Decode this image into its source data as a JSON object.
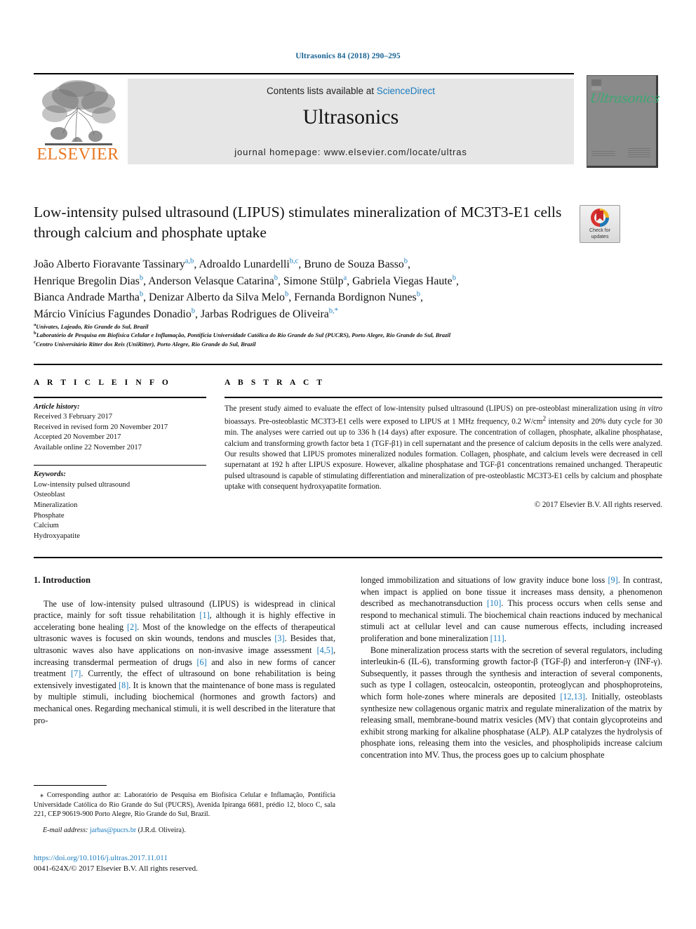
{
  "running_head": "Ultrasonics 84 (2018) 290–295",
  "masthead": {
    "publisher": "ELSEVIER",
    "contents_prefix": "Contents lists available at ",
    "contents_link": "ScienceDirect",
    "journal_name": "Ultrasonics",
    "homepage": "journal homepage: www.elsevier.com/locate/ultras",
    "cover_title": "Ultrasonics"
  },
  "crossmark": {
    "line1": "Check for",
    "line2": "updates"
  },
  "article": {
    "title": "Low-intensity pulsed ultrasound (LIPUS) stimulates mineralization of MC3T3-E1 cells through calcium and phosphate uptake",
    "authors_line1_a": "João Alberto Fioravante Tassinary",
    "authors_line1_a_sup": "a,b",
    "authors_line1_b": ", Adroaldo Lunardelli",
    "authors_line1_b_sup": "b,c",
    "authors_line1_c": ", Bruno de Souza Basso",
    "authors_line1_c_sup": "b",
    "authors_line1_end": ",",
    "authors_line2_a": "Henrique Bregolin Dias",
    "authors_line2_a_sup": "b",
    "authors_line2_b": ", Anderson Velasque Catarina",
    "authors_line2_b_sup": "b",
    "authors_line2_c": ", Simone Stülp",
    "authors_line2_c_sup": "a",
    "authors_line2_d": ", Gabriela Viegas Haute",
    "authors_line2_d_sup": "b",
    "authors_line2_end": ",",
    "authors_line3_a": "Bianca Andrade Martha",
    "authors_line3_a_sup": "b",
    "authors_line3_b": ", Denizar Alberto da Silva Melo",
    "authors_line3_b_sup": "b",
    "authors_line3_c": ", Fernanda Bordignon Nunes",
    "authors_line3_c_sup": "b",
    "authors_line3_end": ",",
    "authors_line4_a": "Márcio Vinícius Fagundes Donadio",
    "authors_line4_a_sup": "b",
    "authors_line4_b": ", Jarbas Rodrigues de Oliveira",
    "authors_line4_b_sup": "b,*",
    "affiliation_a_sup": "a",
    "affiliation_a": "Univates, Lajeado, Rio Grande do Sul, Brazil",
    "affiliation_b_sup": "b",
    "affiliation_b": "Laboratório de Pesquisa em Biofísica Celular e Inflamação, Pontifícia Universidade Católica do Rio Grande do Sul (PUCRS), Porto Alegre, Rio Grande do Sul, Brazil",
    "affiliation_c_sup": "c",
    "affiliation_c": "Centro Universitário Ritter dos Reis (UniRitter), Porto Alegre, Rio Grande do Sul, Brazil"
  },
  "article_info": {
    "heading": "A R T I C L E   I N F O",
    "history_label": "Article history:",
    "history": [
      "Received 3 February 2017",
      "Received in revised form 20 November 2017",
      "Accepted 20 November 2017",
      "Available online 22 November 2017"
    ],
    "keywords_label": "Keywords:",
    "keywords": [
      "Low-intensity pulsed ultrasound",
      "Osteoblast",
      "Mineralization",
      "Phosphate",
      "Calcium",
      "Hydroxyapatite"
    ]
  },
  "abstract": {
    "heading": "A B S T R A C T",
    "text_part1": "The present study aimed to evaluate the effect of low-intensity pulsed ultrasound (LIPUS) on pre-osteoblast mineralization using ",
    "text_italic1": "in vitro",
    "text_part2": " bioassays. Pre-osteoblastic MC3T3-E1 cells were exposed to LIPUS at 1 MHz frequency, 0.2 W/cm",
    "text_sup1": "2",
    "text_part3": " intensity and 20% duty cycle for 30 min. The analyses were carried out up to 336 h (14 days) after exposure. The concentration of collagen, phosphate, alkaline phosphatase, calcium and transforming growth factor beta 1 (TGF-β1) in cell supernatant and the presence of calcium deposits in the cells were analyzed. Our results showed that LIPUS promotes mineralized nodules formation. Collagen, phosphate, and calcium levels were decreased in cell supernatant at 192 h after LIPUS exposure. However, alkaline phosphatase and TGF-β1 concentrations remained unchanged. Therapeutic pulsed ultrasound is capable of stimulating differentiation and mineralization of pre-osteoblastic MC3T3-E1 cells by calcium and phosphate uptake with consequent hydroxyapatite formation.",
    "copyright": "© 2017 Elsevier B.V. All rights reserved."
  },
  "introduction": {
    "heading": "1. Introduction",
    "left_p1_a": "The use of low-intensity pulsed ultrasound (LIPUS) is widespread in clinical practice, mainly for soft tissue rehabilitation ",
    "left_ref1": "[1]",
    "left_p1_b": ", although it is highly effective in accelerating bone healing ",
    "left_ref2": "[2]",
    "left_p1_c": ". Most of the knowledge on the effects of therapeutical ultrasonic waves is focused on skin wounds, tendons and muscles ",
    "left_ref3": "[3]",
    "left_p1_d": ". Besides that, ultrasonic waves also have applications on non-invasive image assessment ",
    "left_ref4": "[4,5]",
    "left_p1_e": ", increasing transdermal permeation of drugs ",
    "left_ref5": "[6]",
    "left_p1_f": " and also in new forms of cancer treatment ",
    "left_ref6": "[7]",
    "left_p1_g": ". Currently, the effect of ultrasound on bone rehabilitation is being extensively investigated ",
    "left_ref7": "[8]",
    "left_p1_h": ". It is known that the maintenance of bone mass is regulated by multiple stimuli, including biochemical (hormones and growth factors) and mechanical ones. Regarding mechanical stimuli, it is well described in the literature that pro-",
    "right_p1_a": "longed immobilization and situations of low gravity induce bone loss ",
    "right_ref1": "[9]",
    "right_p1_b": ". In contrast, when impact is applied on bone tissue it increases mass density, a phenomenon described as mechanotransduction ",
    "right_ref2": "[10]",
    "right_p1_c": ". This process occurs when cells sense and respond to mechanical stimuli. The biochemical chain reactions induced by mechanical stimuli act at cellular level and can cause numerous effects, including increased proliferation and bone mineralization ",
    "right_ref3": "[11]",
    "right_p1_d": ".",
    "right_p2_a": "Bone mineralization process starts with the secretion of several regulators, including interleukin-6 (IL-6), transforming growth factor-β (TGF-β) and interferon-γ (INF-γ). Subsequently, it passes through the synthesis and interaction of several components, such as type I collagen, osteocalcin, osteopontin, proteoglycan and phosphoproteins, which form hole-zones where minerals are deposited ",
    "right_ref4": "[12,13]",
    "right_p2_b": ". Initially, osteoblasts synthesize new collagenous organic matrix and regulate mineralization of the matrix by releasing small, membrane-bound matrix vesicles (MV) that contain glycoproteins and exhibit strong marking for alkaline phosphatase (ALP). ALP catalyzes the hydrolysis of phosphate ions, releasing them into the vesicles, and phospholipids increase calcium concentration into MV. Thus, the process goes up to calcium phosphate"
  },
  "footnote": {
    "star": "⁎ ",
    "corresponding": "Corresponding author at: Laboratório de Pesquisa em Biofísica Celular e Inflamação, Pontifícia Universidade Católica do Rio Grande do Sul (PUCRS), Avenida Ipiranga 6681, prédio 12, bloco C, sala 221, CEP 90619-900 Porto Alegre, Rio Grande do Sul, Brazil.",
    "email_label": "E-mail address:",
    "email": "jarbas@pucrs.br",
    "email_owner": "(J.R.d. Oliveira).",
    "doi": "https://doi.org/10.1016/j.ultras.2017.11.011",
    "issn_line": "0041-624X/© 2017 Elsevier B.V. All rights reserved."
  },
  "colors": {
    "link": "#1a7bbd",
    "running_head": "#1a6496",
    "elsevier_orange": "#e87722",
    "cover_green": "#3aa972"
  }
}
